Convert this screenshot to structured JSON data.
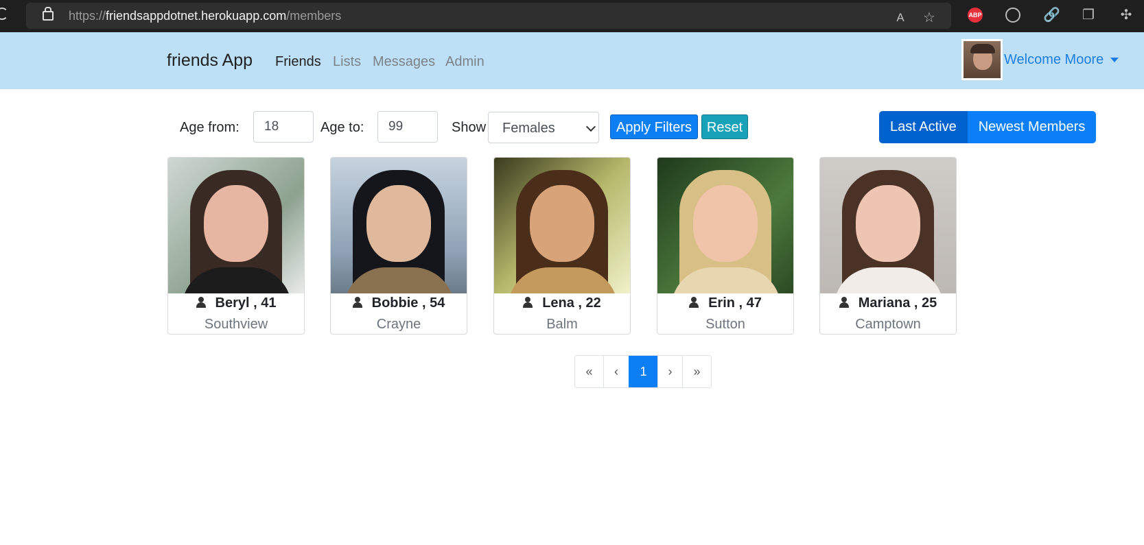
{
  "browser": {
    "url_prefix": "https://",
    "url_host": "friendsappdotnet.herokuapp.com",
    "url_path": "/members"
  },
  "navbar": {
    "brand": "friends App",
    "links": [
      "Friends",
      "Lists",
      "Messages",
      "Admin"
    ],
    "active_link": "Friends",
    "welcome": "Welcome Moore"
  },
  "filters": {
    "age_from_label": "Age from:",
    "age_from_value": "18",
    "age_to_label": "Age to:",
    "age_to_value": "99",
    "show_label": "Show",
    "show_selected": "Females",
    "apply_label": "Apply Filters",
    "reset_label": "Reset",
    "order_options": [
      "Last Active",
      "Newest Members"
    ],
    "order_selected": "Last Active"
  },
  "members": [
    {
      "name": "Beryl , 41",
      "city": "Southview"
    },
    {
      "name": "Bobbie , 54",
      "city": "Crayne"
    },
    {
      "name": "Lena , 22",
      "city": "Balm"
    },
    {
      "name": "Erin , 47",
      "city": "Sutton"
    },
    {
      "name": "Mariana , 25",
      "city": "Camptown"
    }
  ],
  "pagination": {
    "first": "«",
    "prev": "‹",
    "current": "1",
    "next": "›",
    "last": "»"
  },
  "colors": {
    "navbar_bg": "#bee0f7",
    "primary": "#0d7ff5",
    "info": "#17a2b8",
    "active_group": "#0062cc"
  }
}
